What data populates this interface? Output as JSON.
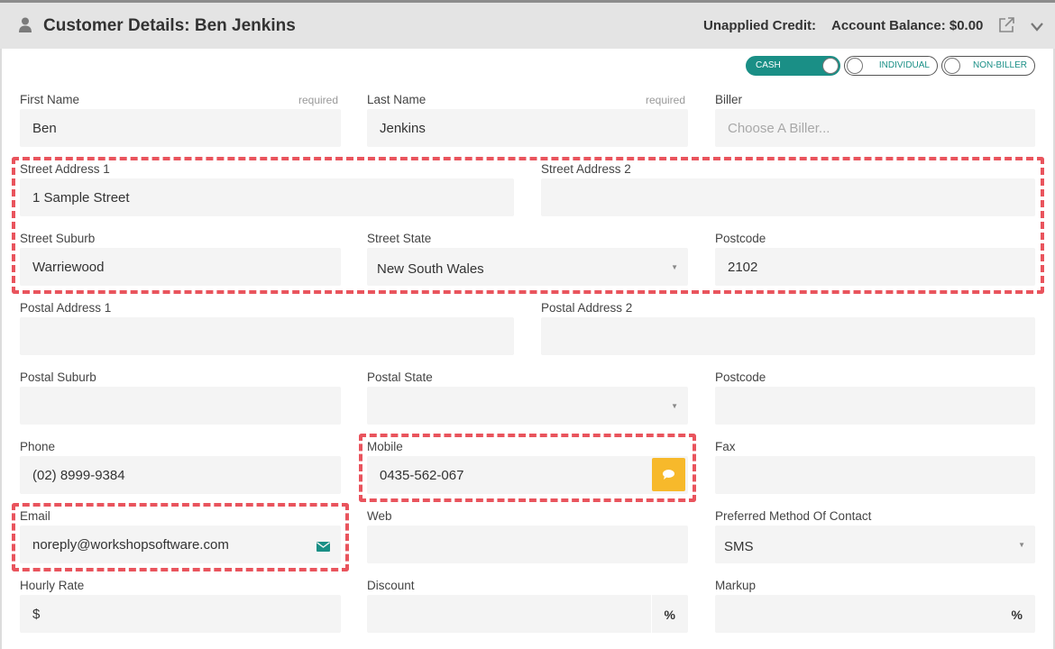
{
  "header": {
    "title": "Customer Details:  Ben Jenkins",
    "unapplied_credit": "Unapplied Credit:",
    "account_balance": "Account Balance: $0.00",
    "icons": [
      "person-icon",
      "external-link-icon",
      "chevron-down-icon"
    ]
  },
  "toggles": [
    {
      "label": "CASH",
      "on": true
    },
    {
      "label": "INDIVIDUAL",
      "on": false
    },
    {
      "label": "NON-BILLER",
      "on": false
    }
  ],
  "required_text": "required",
  "form": {
    "first_name": {
      "label": "First Name",
      "value": "Ben"
    },
    "last_name": {
      "label": "Last Name",
      "value": "Jenkins"
    },
    "biller": {
      "label": "Biller",
      "placeholder": "Choose A Biller..."
    },
    "street_address_1": {
      "label": "Street Address 1",
      "value": "1 Sample Street"
    },
    "street_address_2": {
      "label": "Street Address 2",
      "value": ""
    },
    "street_suburb": {
      "label": "Street Suburb",
      "value": "Warriewood"
    },
    "street_state": {
      "label": "Street State",
      "value": "New South Wales"
    },
    "street_postcode": {
      "label": "Postcode",
      "value": "2102"
    },
    "postal_address_1": {
      "label": "Postal Address 1",
      "value": ""
    },
    "postal_address_2": {
      "label": "Postal Address 2",
      "value": ""
    },
    "postal_suburb": {
      "label": "Postal Suburb",
      "value": ""
    },
    "postal_state": {
      "label": "Postal State",
      "value": ""
    },
    "postal_postcode": {
      "label": "Postcode",
      "value": ""
    },
    "phone": {
      "label": "Phone",
      "value": "(02) 8999-9384"
    },
    "mobile": {
      "label": "Mobile",
      "value": "0435-562-067"
    },
    "fax": {
      "label": "Fax",
      "value": ""
    },
    "email": {
      "label": "Email",
      "value": "noreply@workshopsoftware.com"
    },
    "web": {
      "label": "Web",
      "value": ""
    },
    "preferred_contact": {
      "label": "Preferred Method Of Contact",
      "value": "SMS"
    },
    "hourly_rate": {
      "label": "Hourly Rate",
      "value": "$"
    },
    "discount": {
      "label": "Discount",
      "value": "",
      "unit": "%"
    },
    "markup": {
      "label": "Markup",
      "value": "",
      "unit": "%"
    }
  },
  "colors": {
    "accent": "#1a8f86",
    "sms_button": "#f7b92b",
    "highlight": "#e9545d",
    "field_bg": "#f4f4f4",
    "header_bg": "#e4e4e4"
  }
}
